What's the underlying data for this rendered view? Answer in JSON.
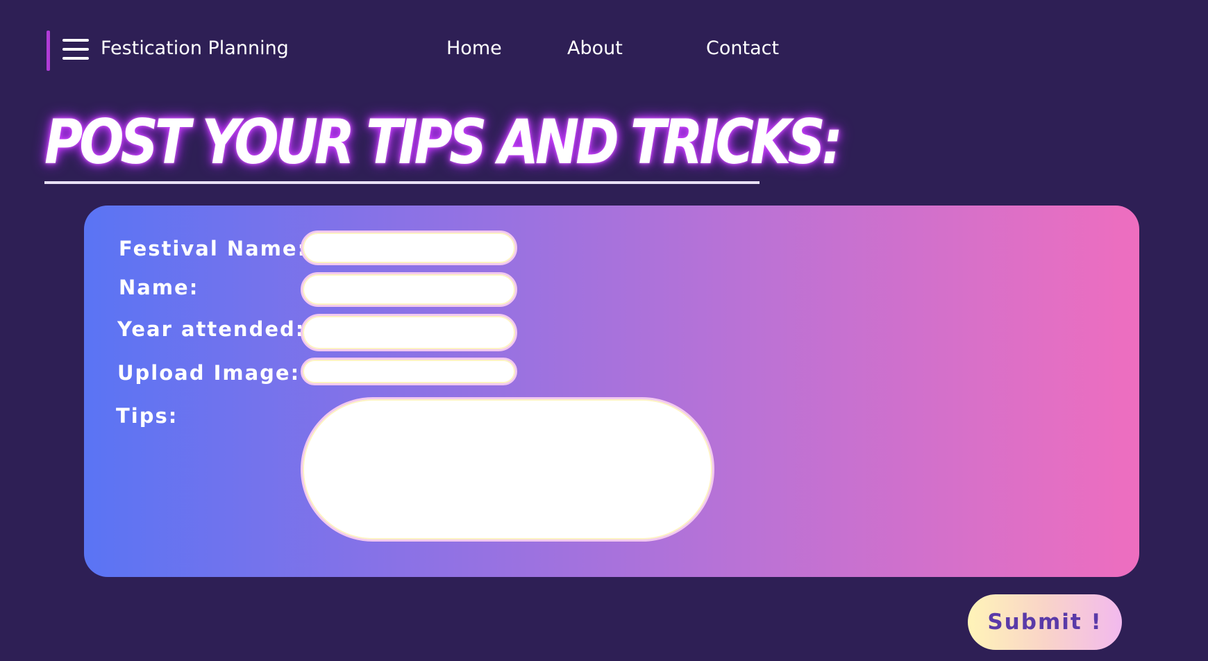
{
  "header": {
    "menu_icon": "hamburger-menu-icon",
    "brand": "Festication Planning",
    "nav": [
      {
        "label": "Home"
      },
      {
        "label": "About"
      },
      {
        "label": "Contact"
      }
    ]
  },
  "title": "Post your tips and tricks:",
  "form": {
    "fields": [
      {
        "label": "Festival Name:",
        "value": ""
      },
      {
        "label": "Name:",
        "value": ""
      },
      {
        "label": "Year attended:",
        "value": ""
      },
      {
        "label": "Upload Image:",
        "value": ""
      },
      {
        "label": "Tips:",
        "value": ""
      }
    ],
    "submit_label": "Submit !"
  },
  "colors": {
    "background": "#2e1f55",
    "accent": "#b03bd6",
    "gradient_start": "#5a74f4",
    "gradient_end": "#ee6ebf",
    "submit_text": "#5a3aa8"
  }
}
